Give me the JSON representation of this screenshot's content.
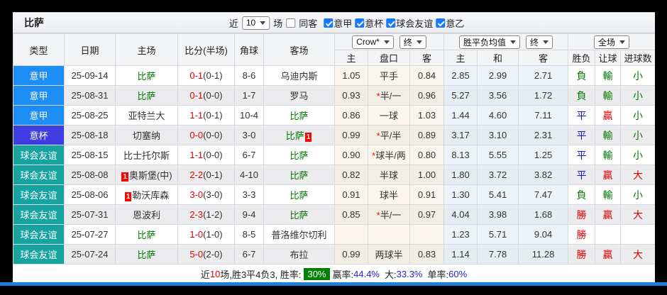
{
  "title": "比萨",
  "controls": {
    "recent_label": "近",
    "recent_select": "10",
    "matches_label": "场",
    "same_away_label": "同客",
    "filters": [
      {
        "label": "意甲",
        "checked": true
      },
      {
        "label": "意杯",
        "checked": true
      },
      {
        "label": "球会友谊",
        "checked": true
      },
      {
        "label": "意乙",
        "checked": true
      }
    ]
  },
  "header": {
    "cols": [
      "类型",
      "日期",
      "主场",
      "比分(半场)",
      "角球",
      "客场"
    ],
    "odds_sub": [
      "主",
      "盘口",
      "客"
    ],
    "avg_sub": [
      "主",
      "和",
      "客"
    ],
    "result_sub": [
      "胜负",
      "让球",
      "进球数"
    ],
    "selects": {
      "bookmaker": "Crow*",
      "odds_final": "终",
      "avg_type": "胜平负均值",
      "avg_final": "终",
      "scope": "全场"
    }
  },
  "rows": [
    {
      "type": "意甲",
      "date": "25-09-14",
      "home": {
        "name": "比萨",
        "subject": true
      },
      "score_ft": "0-1",
      "score_ht": "(0-1)",
      "corners": "8-6",
      "away": {
        "name": "乌迪内斯"
      },
      "odds": {
        "home": "1.05",
        "line": "平手",
        "star": false,
        "away": "0.84"
      },
      "avg": {
        "home": "2.85",
        "draw": "2.99",
        "away": "2.71"
      },
      "res": {
        "wdl": "負",
        "let": "輸",
        "goal": "小"
      }
    },
    {
      "type": "意甲",
      "date": "25-08-31",
      "home": {
        "name": "比萨",
        "subject": true
      },
      "score_ft": "0-1",
      "score_ht": "(0-0)",
      "corners": "1-7",
      "away": {
        "name": "罗马"
      },
      "odds": {
        "home": "0.93",
        "line": "半/一",
        "star": true,
        "away": "0.96"
      },
      "avg": {
        "home": "5.27",
        "draw": "3.56",
        "away": "1.72"
      },
      "res": {
        "wdl": "負",
        "let": "輸",
        "goal": "小"
      }
    },
    {
      "type": "意甲",
      "date": "25-08-25",
      "home": {
        "name": "亚特兰大"
      },
      "score_ft": "1-1",
      "score_ht": "(0-1)",
      "corners": "10-4",
      "away": {
        "name": "比萨",
        "subject": true
      },
      "odds": {
        "home": "0.86",
        "line": "一球",
        "star": false,
        "away": "1.03"
      },
      "avg": {
        "home": "1.44",
        "draw": "4.60",
        "away": "7.11"
      },
      "res": {
        "wdl": "平",
        "let": "贏",
        "goal": "小"
      }
    },
    {
      "type": "意杯",
      "date": "25-08-18",
      "home": {
        "name": "切塞纳"
      },
      "score_ft": "0-0",
      "score_ht": "(0-0)",
      "corners": "3-0",
      "away": {
        "name": "比萨",
        "subject": true,
        "badge": "1",
        "badge_side": "right"
      },
      "odds": {
        "home": "0.99",
        "line": "平/半",
        "star": true,
        "away": "0.89"
      },
      "avg": {
        "home": "3.17",
        "draw": "3.10",
        "away": "2.31"
      },
      "res": {
        "wdl": "平",
        "let": "輸",
        "goal": "小"
      }
    },
    {
      "type": "球会友谊",
      "date": "25-08-15",
      "home": {
        "name": "比士托尔斯"
      },
      "score_ft": "1-1",
      "score_ht": "(0-0)",
      "corners": "6-7",
      "away": {
        "name": "比萨",
        "subject": true
      },
      "odds": {
        "home": "0.90",
        "line": "球半/两",
        "star": true,
        "away": "0.80"
      },
      "avg": {
        "home": "8.13",
        "draw": "5.55",
        "away": "1.25"
      },
      "res": {
        "wdl": "平",
        "let": "輸",
        "goal": "小"
      }
    },
    {
      "type": "球会友谊",
      "date": "25-08-08",
      "home": {
        "name": "奥斯堡(中)",
        "badge": "1",
        "badge_side": "left"
      },
      "score_ft": "2-2",
      "score_ht": "(0-1)",
      "corners": "4-10",
      "away": {
        "name": "比萨",
        "subject": true
      },
      "odds": {
        "home": "0.82",
        "line": "半球",
        "star": false,
        "away": "1.00"
      },
      "avg": {
        "home": "1.80",
        "draw": "3.72",
        "away": "3.82"
      },
      "res": {
        "wdl": "平",
        "let": "贏",
        "goal": "大"
      }
    },
    {
      "type": "球会友谊",
      "date": "25-08-06",
      "home": {
        "name": "勒沃库森",
        "badge": "1",
        "badge_side": "left"
      },
      "score_ft": "3-0",
      "score_ht": "(3-0)",
      "corners": "3-3",
      "away": {
        "name": "比萨",
        "subject": true
      },
      "odds": {
        "home": "0.91",
        "line": "球半",
        "star": false,
        "away": "0.91"
      },
      "avg": {
        "home": "1.30",
        "draw": "5.41",
        "away": "7.47"
      },
      "res": {
        "wdl": "負",
        "let": "輸",
        "goal": "小"
      }
    },
    {
      "type": "球会友谊",
      "date": "25-07-31",
      "home": {
        "name": "恩波利"
      },
      "score_ft": "2-3",
      "score_ht": "(1-2)",
      "corners": "9-4",
      "away": {
        "name": "比萨",
        "subject": true
      },
      "odds": {
        "home": "0.85",
        "line": "半/一",
        "star": true,
        "away": "0.97"
      },
      "avg": {
        "home": "4.04",
        "draw": "3.98",
        "away": "1.68"
      },
      "res": {
        "wdl": "勝",
        "let": "贏",
        "goal": "大"
      }
    },
    {
      "type": "球会友谊",
      "date": "25-07-27",
      "home": {
        "name": "比萨",
        "subject": true
      },
      "score_ft": "1-0",
      "score_ht": "(1-0)",
      "corners": "8-5",
      "away": {
        "name": "普洛维尔切利"
      },
      "odds": {
        "home": "",
        "line": "",
        "star": false,
        "away": ""
      },
      "avg": {
        "home": "1.23",
        "draw": "5.71",
        "away": "9.04"
      },
      "res": {
        "wdl": "勝",
        "let": "",
        "goal": ""
      }
    },
    {
      "type": "球会友谊",
      "date": "25-07-24",
      "home": {
        "name": "比萨",
        "subject": true
      },
      "score_ft": "5-0",
      "score_ht": "(2-0)",
      "corners": "6-7",
      "away": {
        "name": "布拉"
      },
      "odds": {
        "home": "0.99",
        "line": "两球半",
        "star": false,
        "away": "0.83"
      },
      "avg": {
        "home": "1.14",
        "draw": "7.78",
        "away": "11.28"
      },
      "res": {
        "wdl": "勝",
        "let": "贏",
        "goal": "大"
      }
    }
  ],
  "footer": {
    "prefix": "近",
    "count": "10",
    "summary": "场,胜3平4负3, 胜率:",
    "win_rate_badge": "30%",
    "win_label": "赢率:",
    "win_value": "44.4%",
    "big_label": "大:",
    "big_value": "33.3%",
    "single_label": "单率:",
    "single_value": "60%"
  },
  "colors": {
    "type_bg": {
      "意甲": "#1e8ef7",
      "意杯": "#3e3ee2",
      "球会友谊": "#17a4a0"
    },
    "result": {
      "勝": "#e60000",
      "平": "#1414d2",
      "負": "#007a00",
      "贏": "#e60000",
      "輸": "#007a00",
      "大": "#e60000",
      "小": "#007a00"
    },
    "subject_team": "#007a00",
    "score_ft": "#e60000",
    "accent_bar": "#1b80d6",
    "checkbox_blue": "#1677ff",
    "footer_badge_bg": "#008000"
  }
}
